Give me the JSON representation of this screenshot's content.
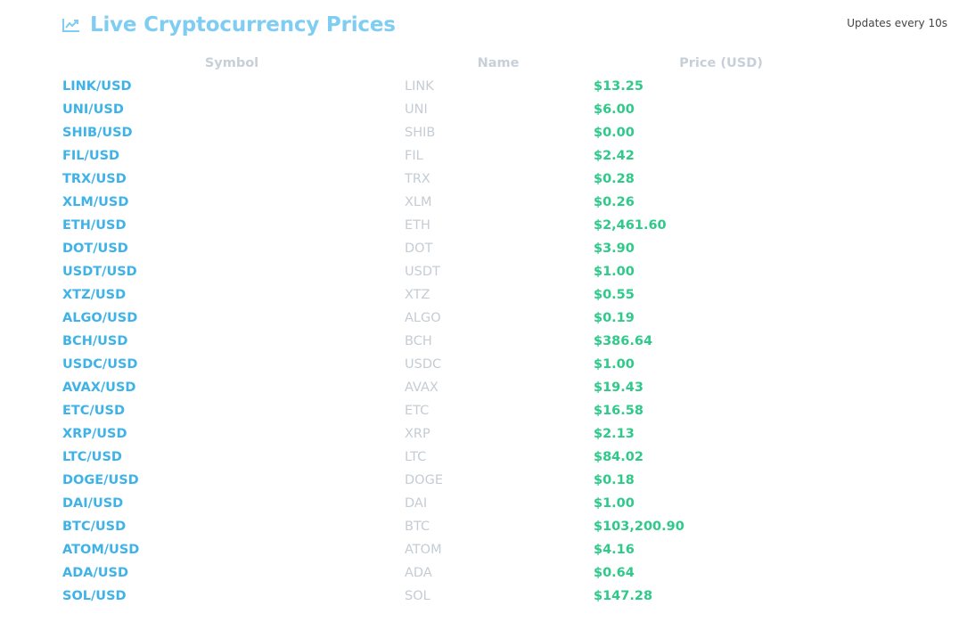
{
  "header": {
    "title": "Live Cryptocurrency Prices",
    "icon": "trending-chart-icon",
    "updates_text": "Updates every 10s"
  },
  "colors": {
    "title": "#7fcdf2",
    "symbol": "#3fb3e8",
    "name": "#c5ccd4",
    "price": "#2fc98a",
    "header_text": "#c7d0d9"
  },
  "table": {
    "columns": [
      "Symbol",
      "Name",
      "Price (USD)"
    ],
    "rows": [
      {
        "symbol": "LINK/USD",
        "name": "LINK",
        "price": "$13.25"
      },
      {
        "symbol": "UNI/USD",
        "name": "UNI",
        "price": "$6.00"
      },
      {
        "symbol": "SHIB/USD",
        "name": "SHIB",
        "price": "$0.00"
      },
      {
        "symbol": "FIL/USD",
        "name": "FIL",
        "price": "$2.42"
      },
      {
        "symbol": "TRX/USD",
        "name": "TRX",
        "price": "$0.28"
      },
      {
        "symbol": "XLM/USD",
        "name": "XLM",
        "price": "$0.26"
      },
      {
        "symbol": "ETH/USD",
        "name": "ETH",
        "price": "$2,461.60"
      },
      {
        "symbol": "DOT/USD",
        "name": "DOT",
        "price": "$3.90"
      },
      {
        "symbol": "USDT/USD",
        "name": "USDT",
        "price": "$1.00"
      },
      {
        "symbol": "XTZ/USD",
        "name": "XTZ",
        "price": "$0.55"
      },
      {
        "symbol": "ALGO/USD",
        "name": "ALGO",
        "price": "$0.19"
      },
      {
        "symbol": "BCH/USD",
        "name": "BCH",
        "price": "$386.64"
      },
      {
        "symbol": "USDC/USD",
        "name": "USDC",
        "price": "$1.00"
      },
      {
        "symbol": "AVAX/USD",
        "name": "AVAX",
        "price": "$19.43"
      },
      {
        "symbol": "ETC/USD",
        "name": "ETC",
        "price": "$16.58"
      },
      {
        "symbol": "XRP/USD",
        "name": "XRP",
        "price": "$2.13"
      },
      {
        "symbol": "LTC/USD",
        "name": "LTC",
        "price": "$84.02"
      },
      {
        "symbol": "DOGE/USD",
        "name": "DOGE",
        "price": "$0.18"
      },
      {
        "symbol": "DAI/USD",
        "name": "DAI",
        "price": "$1.00"
      },
      {
        "symbol": "BTC/USD",
        "name": "BTC",
        "price": "$103,200.90"
      },
      {
        "symbol": "ATOM/USD",
        "name": "ATOM",
        "price": "$4.16"
      },
      {
        "symbol": "ADA/USD",
        "name": "ADA",
        "price": "$0.64"
      },
      {
        "symbol": "SOL/USD",
        "name": "SOL",
        "price": "$147.28"
      }
    ]
  }
}
